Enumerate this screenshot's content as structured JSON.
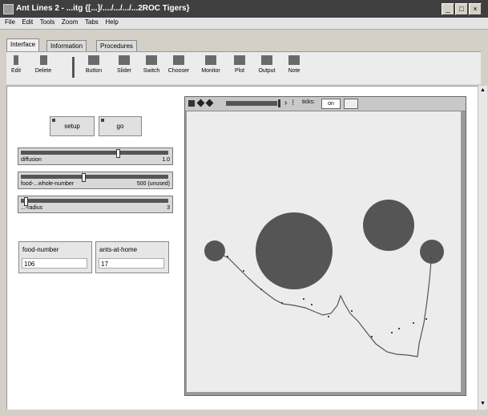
{
  "window": {
    "title": "Ant Lines 2 - ...itg  {[...]/..../.../.../...2ROC Tigers}",
    "buttons": [
      "_",
      "□",
      "×"
    ]
  },
  "menu": {
    "items": [
      "File",
      "Edit",
      "Tools",
      "Zoom",
      "Tabs",
      "Help"
    ]
  },
  "tabs": [
    {
      "label": "Interface"
    },
    {
      "label": "Information"
    },
    {
      "label": "Procedures"
    }
  ],
  "toolbar": {
    "edit_label": "Edit",
    "delete_label": "Delete",
    "items": [
      "Button",
      "Slider",
      "Switch",
      "Chooser",
      "Monitor",
      "Plot",
      "Output",
      "Note"
    ]
  },
  "controls": {
    "setup_label": "setup",
    "go_label": "go",
    "sliders": [
      {
        "label": "diffusion",
        "value": "1.0",
        "fraction": 0.66
      },
      {
        "label": "food-...whole-number",
        "value": "500 (unused)",
        "fraction": 0.42
      },
      {
        "label": "...-radius",
        "value": "3",
        "fraction": 0.02
      }
    ],
    "monitors": [
      {
        "label": "food-number",
        "value": "106"
      },
      {
        "label": "ants-at-home",
        "value": "17"
      }
    ]
  },
  "view": {
    "toolbar_labels": [
      "ticks: ",
      "on"
    ]
  },
  "colors": {
    "titlebar": "#3f3f3f",
    "food": "#555555",
    "world": "#ececec"
  }
}
